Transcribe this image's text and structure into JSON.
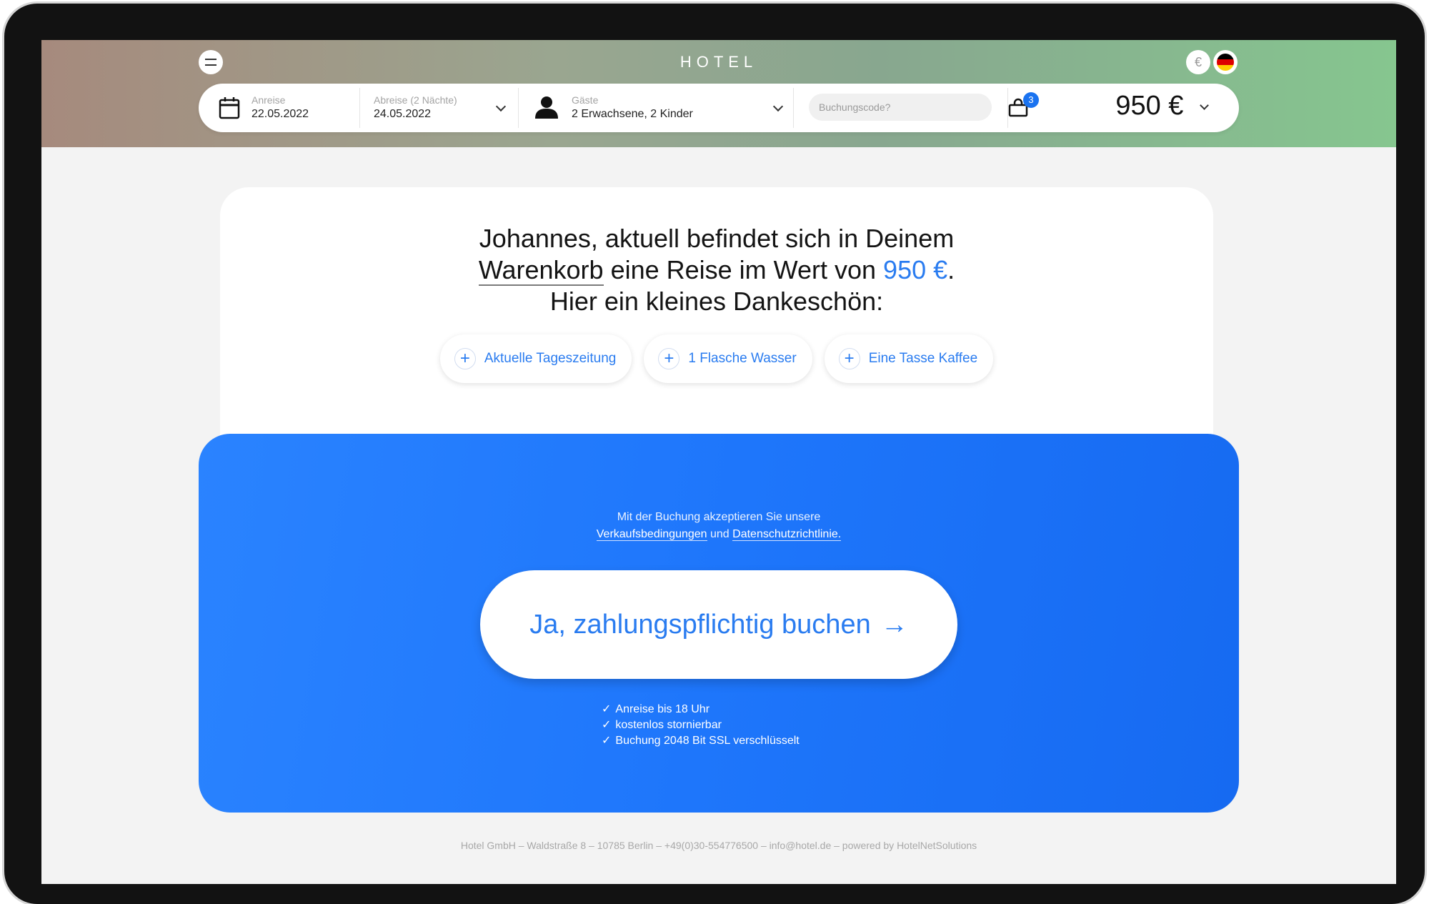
{
  "header": {
    "brand": "HOTEL",
    "currency_symbol": "€"
  },
  "booking": {
    "arrival_label": "Anreise",
    "arrival_value": "22.05.2022",
    "departure_label": "Abreise (2 Nächte)",
    "departure_value": "24.05.2022",
    "guests_label": "Gäste",
    "guests_value": "2 Erwachsene, 2 Kinder",
    "code_placeholder": "Buchungscode?",
    "cart_count": "3",
    "total_price": "950 €"
  },
  "message": {
    "line1": "Johannes, aktuell befindet sich in Deinem",
    "cart_link": "Warenkorb",
    "line2_mid": " eine Reise im Wert von ",
    "amount": "950 €",
    "period": ".",
    "line3": "Hier ein kleines Dankeschön:"
  },
  "extras": [
    {
      "label": "Aktuelle Tageszeitung"
    },
    {
      "label": "1 Flasche Wasser"
    },
    {
      "label": "Eine Tasse Kaffee"
    }
  ],
  "cta": {
    "terms_text": "Mit der Buchung akzeptieren Sie unsere",
    "terms_link": "Verkaufsbedingungen",
    "terms_and": " und ",
    "privacy_link": "Datenschutzrichtlinie.",
    "button_label": "Ja, zahlungspflichtig buchen",
    "button_arrow": "→",
    "benefits": [
      "Anreise bis 18 Uhr",
      "kostenlos stornierbar",
      "Buchung 2048 Bit SSL verschlüsselt"
    ]
  },
  "footer": {
    "text": "Hotel GmbH  –  Waldstraße 8  –  10785 Berlin  –  +49(0)30-554776500  –  info@hotel.de – powered by HotelNetSolutions"
  },
  "colors": {
    "accent": "#2a7cf0",
    "cta_blue": "#1e76fb",
    "badge": "#1a73f0"
  }
}
